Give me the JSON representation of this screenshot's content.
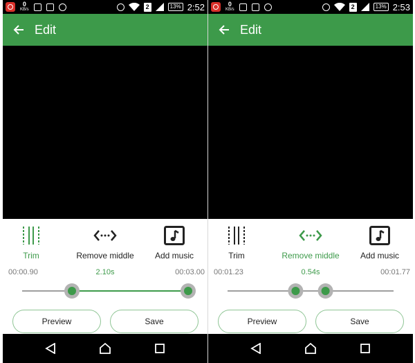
{
  "colors": {
    "accent": "#3d9a4a",
    "appbar": "#3d9a4a",
    "track_inactive": "#9e9e9e",
    "thumb_halo": "#b3b3b3"
  },
  "screens": [
    {
      "status": {
        "kbs_value": "0",
        "kbs_unit": "KB/s",
        "sim": "2",
        "battery": "13%",
        "clock": "2:52"
      },
      "appbar": {
        "title": "Edit"
      },
      "tools": [
        {
          "label": "Trim",
          "icon": "trim-icon",
          "active": true
        },
        {
          "label": "Remove middle",
          "icon": "remove-middle-icon",
          "active": false
        },
        {
          "label": "Add music",
          "icon": "music-note-icon",
          "active": false
        }
      ],
      "times": {
        "start": "00:00.90",
        "duration": "2.10s",
        "end": "00:03.00"
      },
      "range": {
        "start_fraction": 0.3,
        "end_fraction": 1.0,
        "selection_highlighted": true
      },
      "buttons": {
        "preview": "Preview",
        "save": "Save"
      }
    },
    {
      "status": {
        "kbs_value": "0",
        "kbs_unit": "KB/s",
        "sim": "2",
        "battery": "13%",
        "clock": "2:53"
      },
      "appbar": {
        "title": "Edit"
      },
      "tools": [
        {
          "label": "Trim",
          "icon": "trim-icon",
          "active": false
        },
        {
          "label": "Remove middle",
          "icon": "remove-middle-icon",
          "active": true
        },
        {
          "label": "Add music",
          "icon": "music-note-icon",
          "active": false
        }
      ],
      "times": {
        "start": "00:01.23",
        "duration": "0.54s",
        "end": "00:01.77"
      },
      "range": {
        "start_fraction": 0.41,
        "end_fraction": 0.59,
        "selection_highlighted": false
      },
      "buttons": {
        "preview": "Preview",
        "save": "Save"
      }
    }
  ]
}
